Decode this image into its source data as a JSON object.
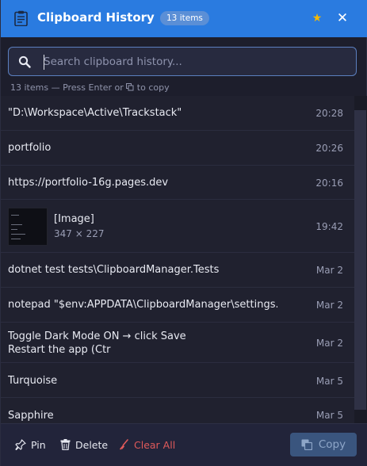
{
  "header": {
    "title": "Clipboard History",
    "count_badge": "13 items",
    "star_icon": "star-icon",
    "close_icon": "close-icon"
  },
  "search": {
    "placeholder": "Search clipboard history...",
    "value": ""
  },
  "status": {
    "prefix": "13 items — Press Enter or",
    "suffix": "to copy"
  },
  "items": [
    {
      "text": "\"D:\\Workspace\\Active\\Trackstack\"",
      "time": "20:28"
    },
    {
      "text": "portfolio",
      "time": "20:26"
    },
    {
      "text": "https://portfolio-16g.pages.dev",
      "time": "20:16"
    },
    {
      "type": "image",
      "label": "[Image]",
      "dims": "347 × 227",
      "time": "19:42"
    },
    {
      "text": "dotnet test tests\\ClipboardManager.Tests",
      "time": "Mar 2"
    },
    {
      "text": "notepad \"$env:APPDATA\\ClipboardManager\\settings.jso...",
      "time": "Mar 2"
    },
    {
      "text": "Toggle Dark Mode ON → click Save",
      "text2": "Restart the app (Ctr",
      "time": "Mar 2"
    },
    {
      "text": "Turquoise",
      "time": "Mar 5"
    },
    {
      "text": "Sapphire",
      "time": "Mar 5"
    }
  ],
  "toolbar": {
    "pin_label": "Pin",
    "delete_label": "Delete",
    "clear_label": "Clear All",
    "copy_label": "Copy"
  },
  "colors": {
    "accent": "#2a7be0",
    "badge": "#5b8fd6",
    "star": "#f5b800",
    "danger": "#e05a5a",
    "copy_button": "#3a557e"
  }
}
